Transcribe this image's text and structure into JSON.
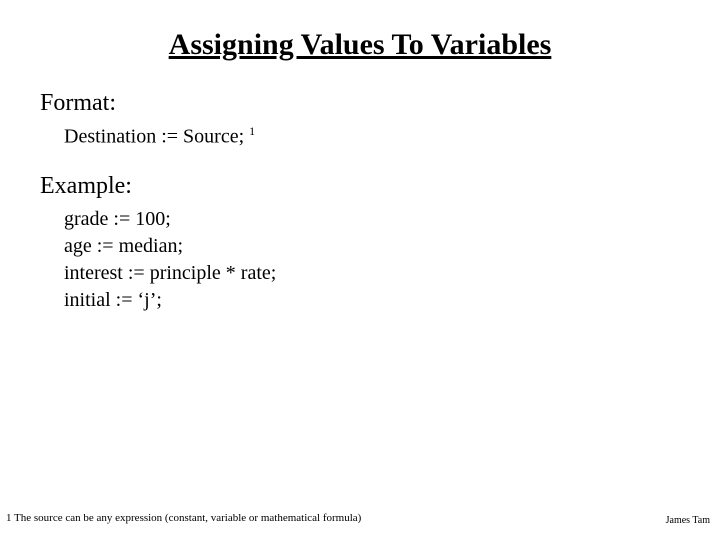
{
  "title": "Assigning Values To Variables",
  "sections": {
    "format": {
      "label": "Format:",
      "line": "Destination := Source;",
      "sup": "1"
    },
    "example": {
      "label": "Example:",
      "lines": [
        "grade := 100;",
        "age := median;",
        "interest := principle * rate;",
        "initial := ‘j’;"
      ]
    }
  },
  "footnote": "1 The source can be any expression (constant, variable or mathematical formula)",
  "author": "James Tam"
}
